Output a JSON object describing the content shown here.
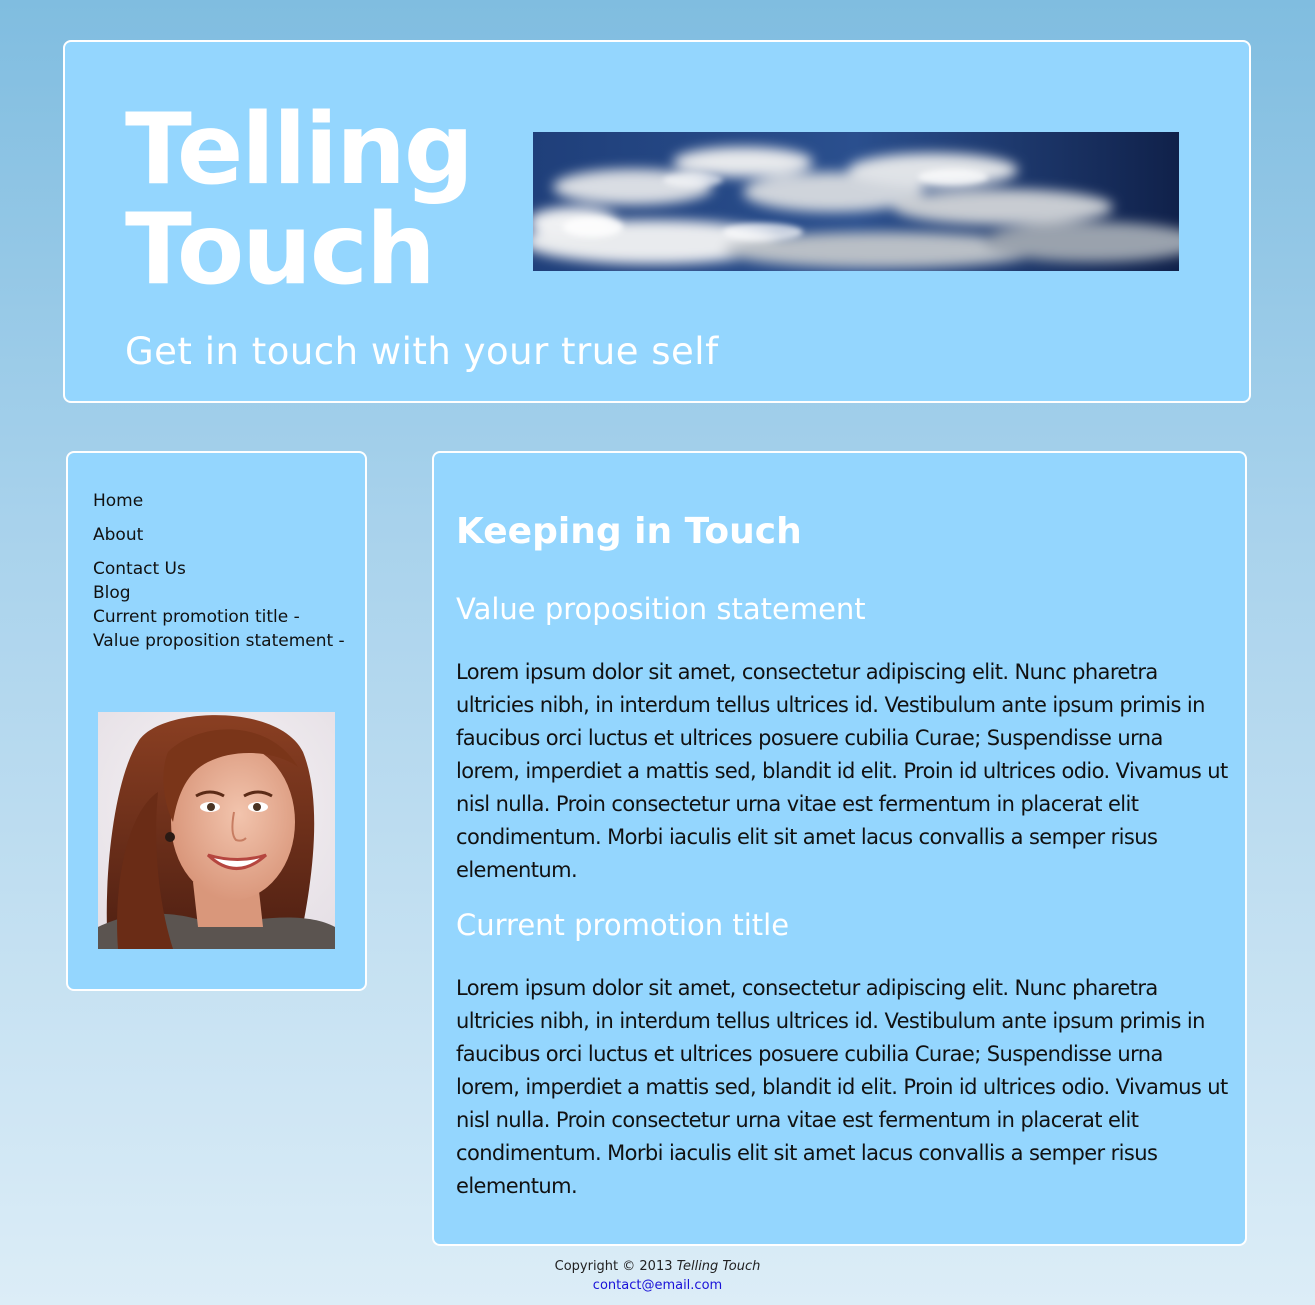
{
  "header": {
    "title_line1": "Telling",
    "title_line2": "Touch",
    "tagline": "Get in touch with your true self"
  },
  "sidebar": {
    "nav": [
      {
        "label": "Home"
      },
      {
        "label": "About"
      },
      {
        "label": "Contact Us"
      },
      {
        "label": "Blog"
      },
      {
        "label": "Current promotion title -"
      },
      {
        "label": "Value proposition statement -"
      }
    ]
  },
  "main": {
    "title": "Keeping in Touch",
    "sections": [
      {
        "title": "Value proposition statement",
        "body": "Lorem ipsum dolor sit amet, consectetur adipiscing elit. Nunc pharetra ultricies nibh, in interdum tellus ultrices id. Vestibulum ante ipsum primis in faucibus orci luctus et ultrices posuere cubilia Curae; Suspendisse urna lorem, imperdiet a mattis sed, blandit id elit. Proin id ultrices odio. Vivamus ut nisl nulla. Proin consectetur urna vitae est fermentum in placerat elit condimentum. Morbi iaculis elit sit amet lacus convallis a semper risus elementum."
      },
      {
        "title": "Current promotion title",
        "body": "Lorem ipsum dolor sit amet, consectetur adipiscing elit. Nunc pharetra ultricies nibh, in interdum tellus ultrices id. Vestibulum ante ipsum primis in faucibus orci luctus et ultrices posuere cubilia Curae; Suspendisse urna lorem, imperdiet a mattis sed, blandit id elit. Proin id ultrices odio. Vivamus ut nisl nulla. Proin consectetur urna vitae est fermentum in placerat elit condimentum. Morbi iaculis elit sit amet lacus convallis a semper risus elementum."
      }
    ]
  },
  "footer": {
    "copyright": "Copyright © 2013",
    "site_name": "Telling Touch",
    "email": "contact@email.com"
  },
  "colors": {
    "panel_bg": "#94d6fe",
    "panel_border": "#ffffff",
    "link": "#1a12d8"
  }
}
